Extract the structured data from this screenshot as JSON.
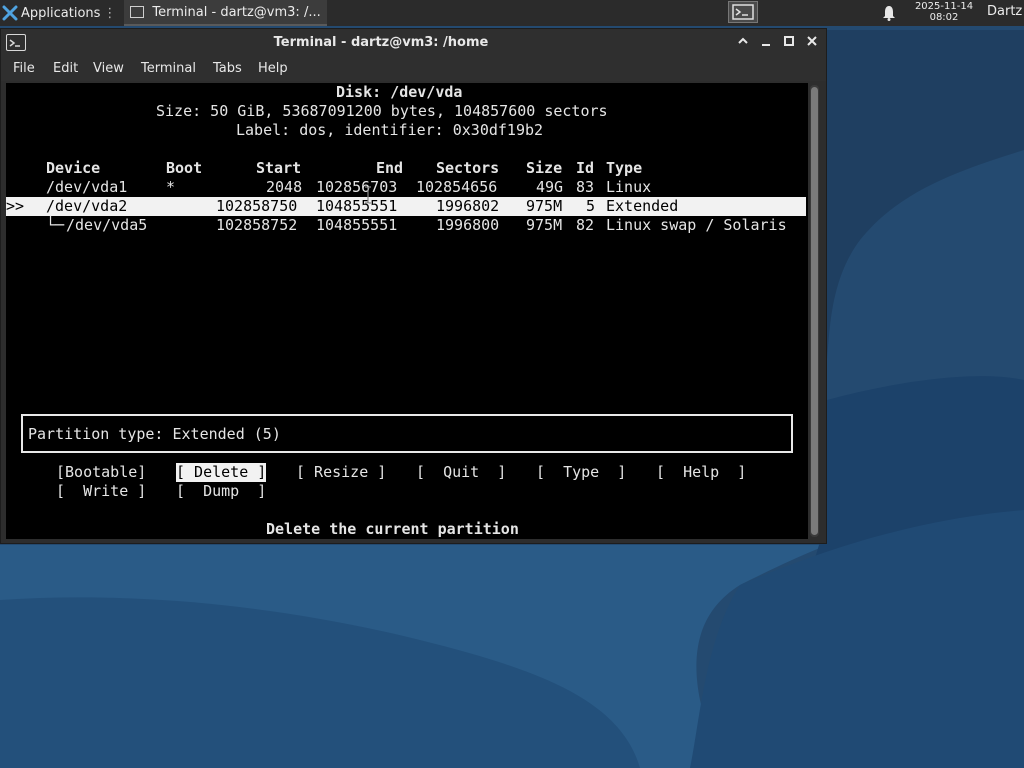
{
  "panel": {
    "applications_label": "Applications",
    "task_label": "Terminal - dartz@vm3: /...",
    "clock_date": "2025-11-14",
    "clock_time": "08:02",
    "user": "Dartz"
  },
  "window": {
    "title": "Terminal - dartz@vm3: /home",
    "menu": [
      "File",
      "Edit",
      "View",
      "Terminal",
      "Tabs",
      "Help"
    ]
  },
  "cfdisk": {
    "disk_line": "Disk: /dev/vda",
    "size_line": "Size: 50 GiB, 53687091200 bytes, 104857600 sectors",
    "label_line": "Label: dos, identifier: 0x30df19b2",
    "headers": {
      "device": "Device",
      "boot": "Boot",
      "start": "Start",
      "end": "End",
      "sectors": "Sectors",
      "size": "Size",
      "id": "Id",
      "type": "Type"
    },
    "rows": [
      {
        "marker": "",
        "device": "/dev/vda1",
        "boot": "*",
        "start": "2048",
        "end": "102856703",
        "sectors": "102854656",
        "size": "49G",
        "id": "83",
        "type": "Linux"
      },
      {
        "marker": ">>",
        "device": "/dev/vda2",
        "boot": "",
        "start": "102858750",
        "end": "104855551",
        "sectors": "1996802",
        "size": "975M",
        "id": "5",
        "type": "Extended"
      },
      {
        "marker": "",
        "device": "/dev/vda5",
        "boot": "",
        "start": "102858752",
        "end": "104855551",
        "sectors": "1996800",
        "size": "975M",
        "id": "82",
        "type": "Linux swap / Solaris"
      }
    ],
    "status": "Partition type: Extended (5)",
    "buttons_row1": [
      "[Bootable]",
      "[ Delete ]",
      "[ Resize ]",
      "[  Quit  ]",
      "[  Type  ]",
      "[  Help  ]"
    ],
    "buttons_row2": [
      "[  Write ]",
      "[  Dump  ]"
    ],
    "selected_button": "[ Delete ]",
    "hint": "Delete the current partition"
  },
  "colors": {
    "panel_bg": "#2b2b2b",
    "window_bg": "#2f2f2f",
    "terminal_bg": "#000000",
    "terminal_fg": "#e5e5e5",
    "highlight_bg": "#f2f2f2",
    "desktop_bg": "#24476a"
  }
}
